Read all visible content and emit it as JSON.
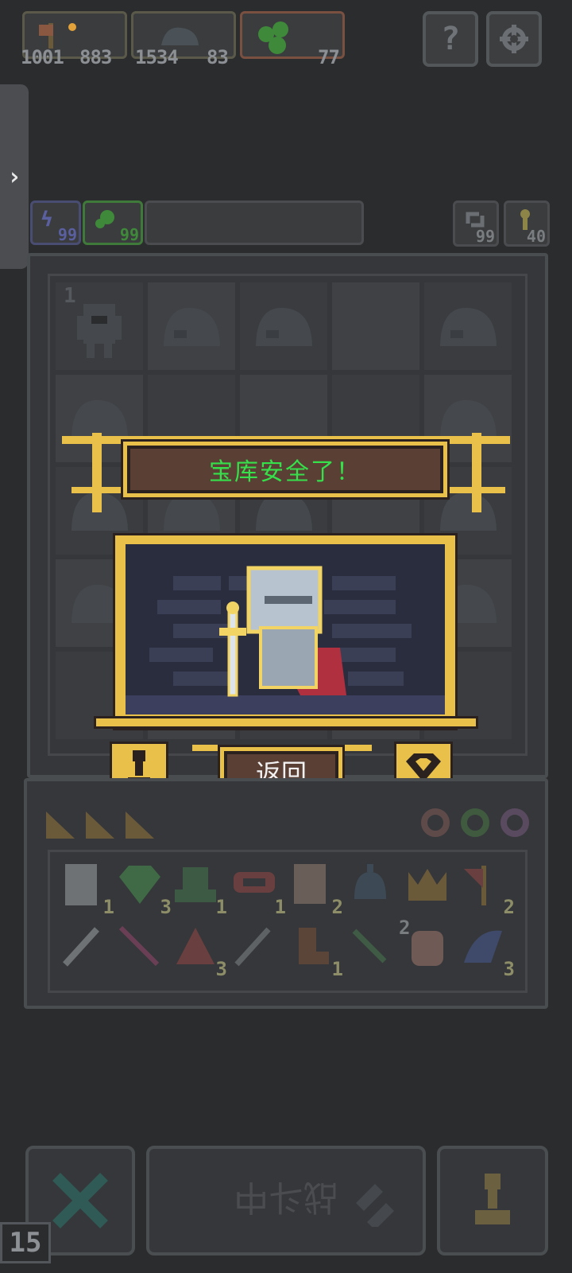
{
  "top_bar": {
    "resource_counts": [
      "1001",
      "883",
      "1534",
      "83",
      "77"
    ],
    "help_icon": "question-icon",
    "settings_icon": "gear-icon"
  },
  "side_tab": {
    "arrow": "›"
  },
  "stats_left": {
    "energy": "99",
    "seeds": "99"
  },
  "stats_right": {
    "refresh": "99",
    "keys": "40"
  },
  "vault": {
    "first_cell_number": "1"
  },
  "modal": {
    "title": "宝库安全了！",
    "return_label": "返回"
  },
  "inventory": {
    "counts_row1": [
      "1",
      "3",
      "1",
      "1",
      "2",
      "",
      "",
      "2"
    ],
    "counts_row2": [
      "",
      "",
      "3",
      "",
      "1",
      "",
      "2",
      "3"
    ]
  },
  "bottom": {
    "battle_label": "战斗中",
    "level": "15"
  },
  "colors": {
    "gold": "#e9c04a",
    "banner_bg": "#5a3f35",
    "title_green": "#35e04a"
  }
}
